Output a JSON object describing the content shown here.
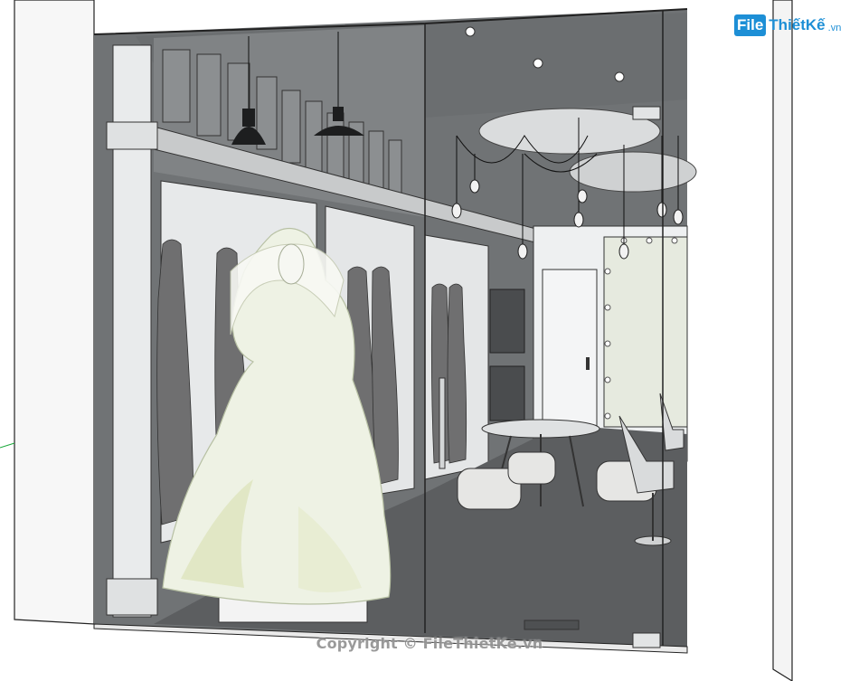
{
  "logo": {
    "mark": "File",
    "rest": "ThiếtKế",
    "domain": ".vn"
  },
  "watermark": {
    "text": "Copyright © FileThietKe.vn"
  },
  "colors": {
    "interior_dark": "#5e6163",
    "floor": "#5a5c5e",
    "wall_light": "#eef0f1",
    "gown": "#eef2e4",
    "accent_logo": "#1d8fd6"
  }
}
